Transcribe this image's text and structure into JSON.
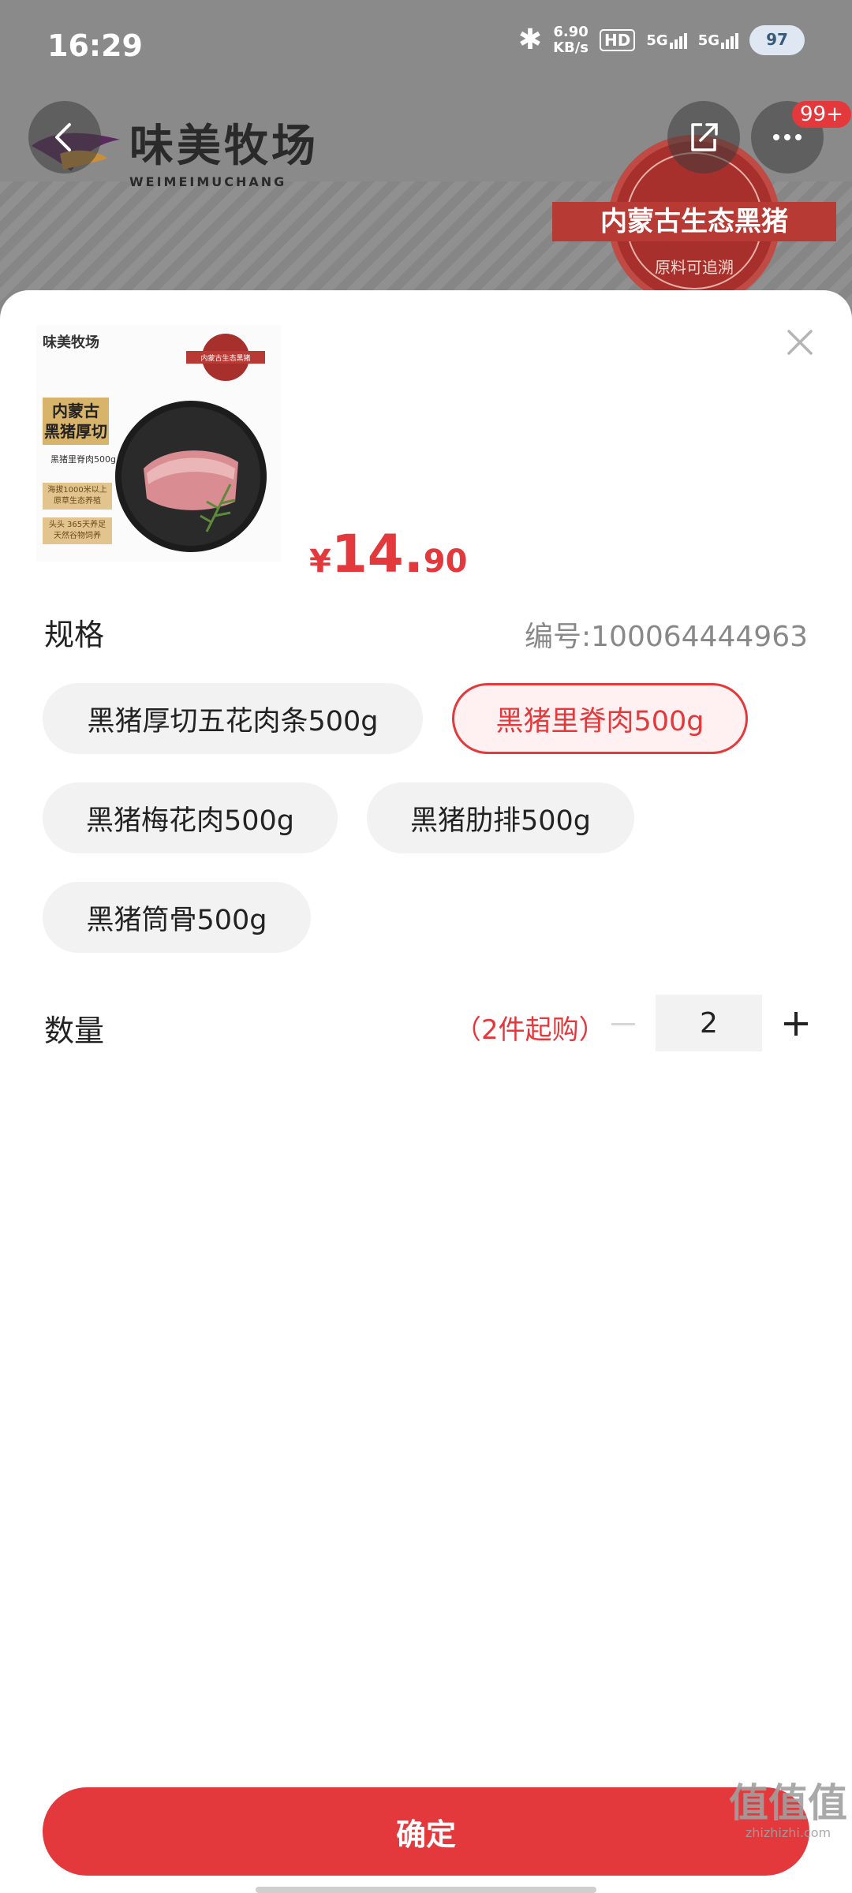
{
  "status_bar": {
    "time": "16:29",
    "net_speed_value": "6.90",
    "net_speed_unit": "KB/s",
    "hd_label": "HD",
    "signal1_label": "5G",
    "signal2_label": "5G",
    "battery": "97"
  },
  "background_page": {
    "brand_name": "味美牧场",
    "brand_name_en": "WEIMEIMUCHANG",
    "stamp_text": "内蒙古生态黑猪",
    "stamp_sub": "原料可追溯",
    "message_badge": "99+"
  },
  "thumbnail": {
    "brand": "味美牧场",
    "stamp": "内蒙古生态黑猪",
    "title_line1": "内蒙古",
    "title_line2": "黑猪厚切",
    "subtitle": "黑猪里脊肉500g",
    "tag1_line1": "海拔1000米以上",
    "tag1_line2": "原草生态养殖",
    "tag2_line1": "头头 365天养足",
    "tag2_line2": "天然谷物饲养"
  },
  "price": {
    "currency": "¥",
    "integer": "14.",
    "decimal": "90"
  },
  "spec": {
    "label": "规格",
    "sku": "编号:100064444963",
    "options": [
      {
        "label": "黑猪厚切五花肉条500g",
        "selected": false
      },
      {
        "label": "黑猪里脊肉500g",
        "selected": true
      },
      {
        "label": "黑猪梅花肉500g",
        "selected": false
      },
      {
        "label": "黑猪肋排500g",
        "selected": false
      },
      {
        "label": "黑猪筒骨500g",
        "selected": false
      }
    ]
  },
  "quantity": {
    "label": "数量",
    "min_note": "（2件起购）",
    "value": "2"
  },
  "confirm_label": "确定",
  "watermark": {
    "main": "值值值",
    "sub": "zhizhizhi.com"
  },
  "colors": {
    "accent": "#e4393c",
    "chip_bg": "#f2f2f2",
    "selected_chip_bg": "#fff1f1"
  },
  "icons": [
    "back-arrow-icon",
    "share-icon",
    "more-icon",
    "close-icon",
    "minus-icon",
    "plus-icon",
    "bluetooth-icon"
  ]
}
